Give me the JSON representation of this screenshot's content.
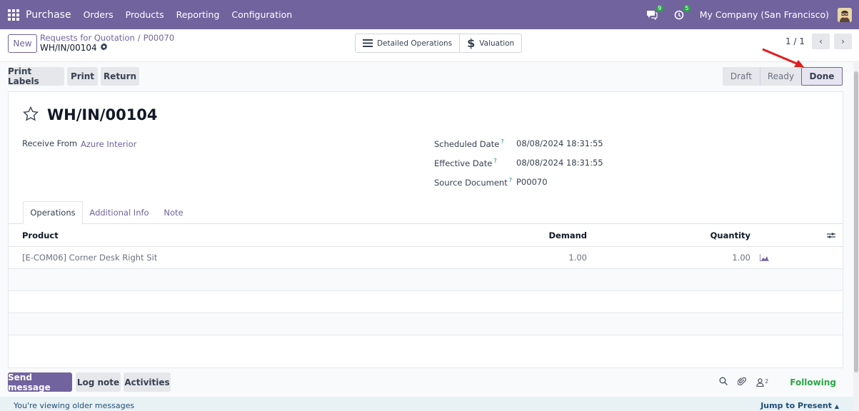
{
  "navbar": {
    "app_name": "Purchase",
    "menu": [
      "Orders",
      "Products",
      "Reporting",
      "Configuration"
    ],
    "messages_count": "9",
    "activities_count": "5",
    "company": "My Company (San Francisco)"
  },
  "control": {
    "new_label": "New",
    "breadcrumb": [
      "Requests for Quotation",
      "P00070"
    ],
    "record_name": "WH/IN/00104",
    "smart_buttons": [
      "Detailed Operations",
      "Valuation"
    ],
    "pager": "1 / 1"
  },
  "actions": {
    "buttons": [
      "Print Labels",
      "Print",
      "Return"
    ],
    "statuses": [
      "Draft",
      "Ready",
      "Done"
    ],
    "active_status": "Done"
  },
  "form": {
    "title": "WH/IN/00104",
    "receive_from_label": "Receive From",
    "receive_from_value": "Azure Interior",
    "scheduled_date_label": "Scheduled Date",
    "scheduled_date_value": "08/08/2024 18:31:55",
    "effective_date_label": "Effective Date",
    "effective_date_value": "08/08/2024 18:31:55",
    "source_document_label": "Source Document",
    "source_document_value": "P00070",
    "help_mark": "?",
    "tabs": [
      "Operations",
      "Additional Info",
      "Note"
    ],
    "table": {
      "headers": [
        "Product",
        "Demand",
        "Quantity"
      ],
      "rows": [
        {
          "product": "[E-COM06] Corner Desk Right Sit",
          "demand": "1.00",
          "quantity": "1.00"
        }
      ]
    }
  },
  "chatter": {
    "send_message": "Send message",
    "log_note": "Log note",
    "activities": "Activities",
    "followers_count": "2",
    "following": "Following",
    "older_messages": "You're viewing older messages",
    "jump_to_present": "Jump to Present"
  },
  "colors": {
    "brand": "#71639e",
    "success": "#28a745",
    "annotation_arrow": "#e11d1d"
  }
}
